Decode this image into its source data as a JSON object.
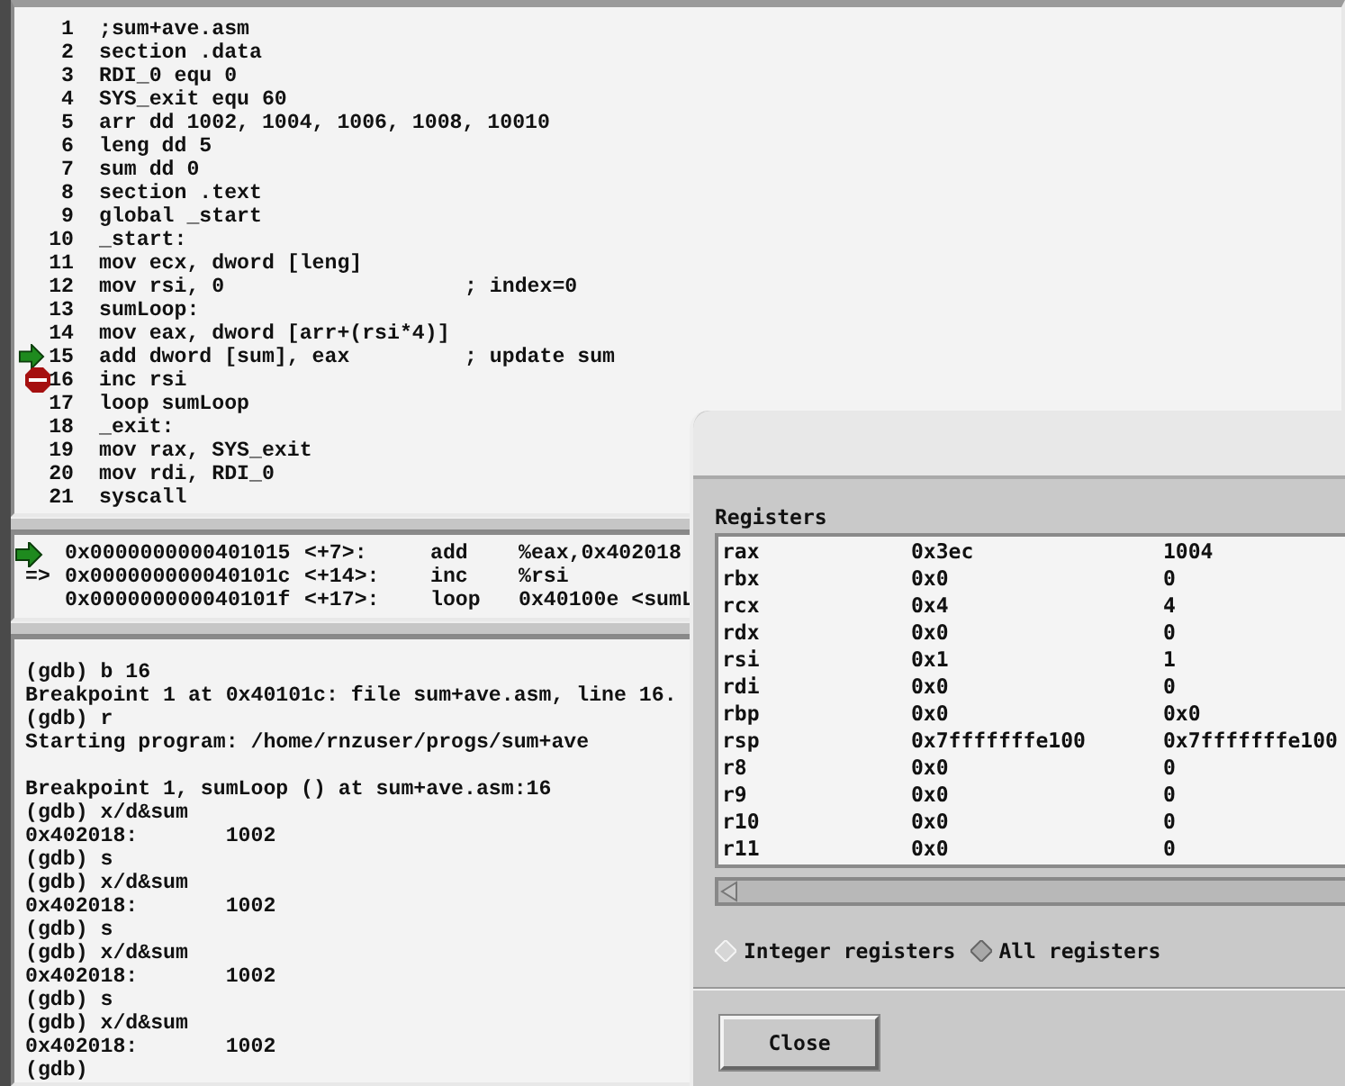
{
  "source": {
    "lines": [
      {
        "number": "1",
        "code": ";sum+ave.asm",
        "current": false,
        "breakpoint": false
      },
      {
        "number": "2",
        "code": "section .data",
        "current": false,
        "breakpoint": false
      },
      {
        "number": "3",
        "code": "RDI_0 equ 0",
        "current": false,
        "breakpoint": false
      },
      {
        "number": "4",
        "code": "SYS_exit equ 60",
        "current": false,
        "breakpoint": false
      },
      {
        "number": "5",
        "code": "arr dd 1002, 1004, 1006, 1008, 10010",
        "current": false,
        "breakpoint": false
      },
      {
        "number": "6",
        "code": "leng dd 5",
        "current": false,
        "breakpoint": false
      },
      {
        "number": "7",
        "code": "sum dd 0",
        "current": false,
        "breakpoint": false
      },
      {
        "number": "8",
        "code": "section .text",
        "current": false,
        "breakpoint": false
      },
      {
        "number": "9",
        "code": "global _start",
        "current": false,
        "breakpoint": false
      },
      {
        "number": "10",
        "code": "_start:",
        "current": false,
        "breakpoint": false
      },
      {
        "number": "11",
        "code": "mov ecx, dword [leng]",
        "current": false,
        "breakpoint": false
      },
      {
        "number": "12",
        "code": "mov rsi, 0",
        "comment": "; index=0",
        "current": false,
        "breakpoint": false
      },
      {
        "number": "13",
        "code": "sumLoop:",
        "current": false,
        "breakpoint": false
      },
      {
        "number": "14",
        "code": "mov eax, dword [arr+(rsi*4)]",
        "current": false,
        "breakpoint": false
      },
      {
        "number": "15",
        "code": "add dword [sum], eax",
        "comment": "; update sum",
        "current": true,
        "breakpoint": false
      },
      {
        "number": "16",
        "code": "inc rsi",
        "current": false,
        "breakpoint": true
      },
      {
        "number": "17",
        "code": "loop sumLoop",
        "current": false,
        "breakpoint": false
      },
      {
        "number": "18",
        "code": "_exit:",
        "current": false,
        "breakpoint": false
      },
      {
        "number": "19",
        "code": "mov rax, SYS_exit",
        "current": false,
        "breakpoint": false
      },
      {
        "number": "20",
        "code": "mov rdi, RDI_0",
        "current": false,
        "breakpoint": false
      },
      {
        "number": "21",
        "code": "syscall",
        "current": false,
        "breakpoint": false
      }
    ]
  },
  "machine_code": {
    "rows": [
      {
        "current": true,
        "address": "0x0000000000401015",
        "offset": "<+7>:",
        "mnemonic": "add",
        "operands": "%eax,0x402018"
      },
      {
        "current": false,
        "pointer": "=>",
        "address": "0x000000000040101c",
        "offset": "<+14>:",
        "mnemonic": "inc",
        "operands": "%rsi"
      },
      {
        "current": false,
        "address": "0x000000000040101f",
        "offset": "<+17>:",
        "mnemonic": "loop",
        "operands": "0x40100e <sumL"
      }
    ]
  },
  "console": {
    "blocks": [
      [
        "(gdb) b 16",
        "Breakpoint 1 at 0x40101c: file sum+ave.asm, line 16.",
        "(gdb) r",
        "Starting program: /home/rnzuser/progs/sum+ave"
      ],
      [
        "Breakpoint 1, sumLoop () at sum+ave.asm:16",
        "(gdb) x/d&sum",
        "0x402018:       1002",
        "(gdb) s",
        "(gdb) x/d&sum",
        "0x402018:       1002",
        "(gdb) s",
        "(gdb) x/d&sum",
        "0x402018:       1002",
        "(gdb) s",
        "(gdb) x/d&sum",
        "0x402018:       1002",
        "(gdb)"
      ]
    ]
  },
  "registers_dialog": {
    "heading": "Registers",
    "registers": [
      {
        "name": "rax",
        "hex": "0x3ec",
        "natural": "1004"
      },
      {
        "name": "rbx",
        "hex": "0x0",
        "natural": "0"
      },
      {
        "name": "rcx",
        "hex": "0x4",
        "natural": "4"
      },
      {
        "name": "rdx",
        "hex": "0x0",
        "natural": "0"
      },
      {
        "name": "rsi",
        "hex": "0x1",
        "natural": "1"
      },
      {
        "name": "rdi",
        "hex": "0x0",
        "natural": "0"
      },
      {
        "name": "rbp",
        "hex": "0x0",
        "natural": "0x0"
      },
      {
        "name": "rsp",
        "hex": "0x7fffffffe100",
        "natural": "0x7fffffffe100"
      },
      {
        "name": "r8",
        "hex": "0x0",
        "natural": "0"
      },
      {
        "name": "r9",
        "hex": "0x0",
        "natural": "0"
      },
      {
        "name": "r10",
        "hex": "0x0",
        "natural": "0"
      },
      {
        "name": "r11",
        "hex": "0x0",
        "natural": "0"
      }
    ],
    "options": [
      {
        "label": "Integer registers",
        "selected": false
      },
      {
        "label": "All registers",
        "selected": true
      }
    ],
    "close_button": "Close"
  }
}
